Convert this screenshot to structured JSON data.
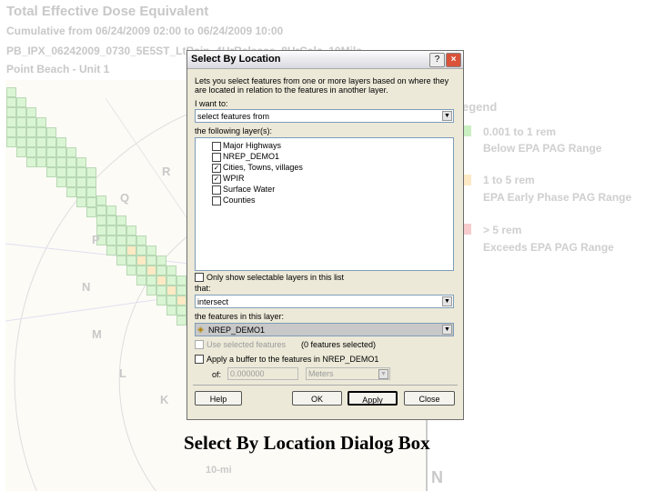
{
  "header": {
    "title": "Total Effective Dose Equivalent",
    "subtitle": "Cumulative from 06/24/2009 02:00 to 06/24/2009 10:00",
    "run_id": "PB_IPX_06242009_0730_5E5ST_LtRain_4HrRelease_8HrCalc_10Mile",
    "site": "Point Beach - Unit 1"
  },
  "map": {
    "sectors": [
      "R",
      "Q",
      "P",
      "N",
      "M",
      "L",
      "K"
    ],
    "scale_label": "10-mi",
    "north_label": "N"
  },
  "legend": {
    "title": "egend",
    "items": [
      {
        "range": "0.001 to 1 rem",
        "desc": "Below EPA PAG Range",
        "color": "#c8f0c0"
      },
      {
        "range": "1 to 5 rem",
        "desc": "EPA Early Phase PAG Range",
        "color": "#fde9c4"
      },
      {
        "range": "> 5 rem",
        "desc": "Exceeds EPA PAG Range",
        "color": "#f6cccc"
      }
    ]
  },
  "dialog": {
    "title": "Select By Location",
    "help_icon": "?",
    "close_icon": "×",
    "description": "Lets you select features from one or more layers based on where they are located in relation to the features in another layer.",
    "want_label": "I want to:",
    "want_value": "select features from",
    "layers_label": "the following layer(s):",
    "layers": [
      {
        "name": "Major Highways",
        "checked": false
      },
      {
        "name": "NREP_DEMO1",
        "checked": false
      },
      {
        "name": "Cities, Towns, villages",
        "checked": true
      },
      {
        "name": "WPIR",
        "checked": true
      },
      {
        "name": "Surface Water",
        "checked": false
      },
      {
        "name": "Counties",
        "checked": false
      }
    ],
    "only_selectable": "Only show selectable layers in this list",
    "that_label": "that:",
    "that_value": "intersect",
    "features_label": "the features in this layer:",
    "features_value": "NREP_DEMO1",
    "use_selected": "Use selected features",
    "selected_count": "(0 features selected)",
    "buffer_label": "Apply a buffer to the features in NREP_DEMO1",
    "of_label": "of:",
    "buffer_value": "0.000000",
    "buffer_unit": "Meters",
    "buttons": {
      "help": "Help",
      "ok": "OK",
      "apply": "Apply",
      "close": "Close"
    }
  },
  "caption": "Select By Location Dialog Box"
}
